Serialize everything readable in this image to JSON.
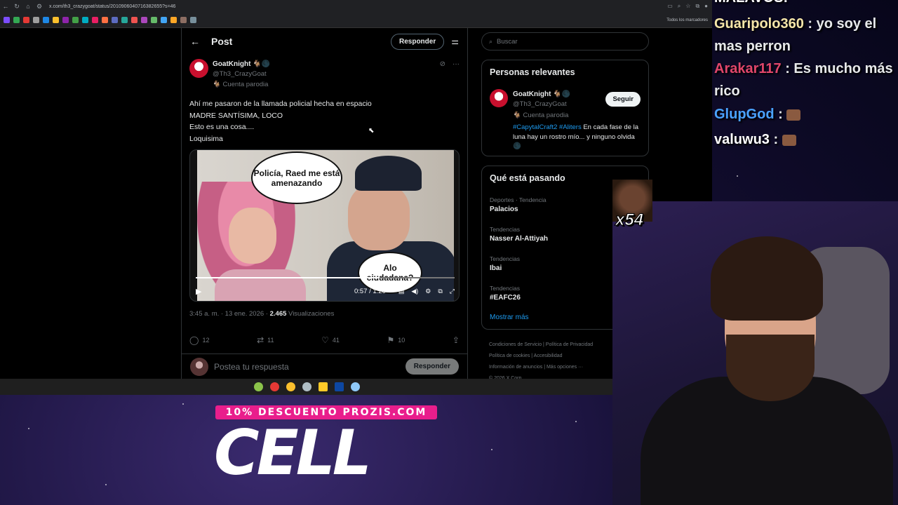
{
  "browser": {
    "url": "x.com/th3_crazygoat/status/2010906040716382655?s=46",
    "bookmarks_all": "Todos los marcadores"
  },
  "post": {
    "header_title": "Post",
    "reply_top_label": "Responder",
    "author_name": "GoatKnight 🐐🌑",
    "author_handle": "@Th3_CrazyGoat",
    "author_tag": "🐐 Cuenta parodia",
    "text_lines": [
      "Ahí me pasaron de la llamada policial hecha en espacio",
      "MADRE SANTÍSIMA, LOCO",
      "Esto es una cosa....",
      "Loquisima"
    ],
    "meme_bubble_1": "Policía, Raed me está amenazando",
    "meme_bubble_2": "Alo ciudadana?",
    "video_time": "0:57 / 1:20",
    "video_progress": 0.71,
    "meta_time": "3:45 a. m. · 13 ene. 2026 · ",
    "meta_views": "2.465",
    "meta_views_label": " Visualizaciones",
    "actions": {
      "replies": "12",
      "reposts": "11",
      "likes": "41",
      "bookmarks": "10"
    },
    "reply_placeholder": "Postea tu respuesta",
    "reply_submit": "Responder"
  },
  "sidebar": {
    "search_placeholder": "Buscar",
    "people_title": "Personas relevantes",
    "rel_name": "GoatKnight 🐐🌑",
    "rel_handle": "@Th3_CrazyGoat",
    "rel_tag": "🐐 Cuenta parodia",
    "rel_bio_tag1": "#CapytalCraft2",
    "rel_bio_tag2": "#Aliters",
    "rel_bio_text": " En cada fase de la luna hay un rostro mío... y ninguno olvida 🌑",
    "follow_label": "Seguir",
    "trends_title": "Qué está pasando",
    "trends": [
      {
        "category": "Deportes · Tendencia",
        "name": "Palacios"
      },
      {
        "category": "Tendencias",
        "name": "Nasser Al-Attiyah"
      },
      {
        "category": "Tendencias",
        "name": "Ibai"
      },
      {
        "category": "Tendencias",
        "name": "#EAFC26"
      }
    ],
    "show_more": "Mostrar más",
    "footer_lines": [
      "Condiciones de Servicio  |  Política de Privacidad",
      "Política de cookies  |  Accesibilidad",
      "Información de anuncios  |  Más opciones ···",
      "© 2026 X Corp."
    ]
  },
  "chat": {
    "partial_top": "MALAVOS!",
    "lines": [
      {
        "user": "Guaripolo360",
        "color": "#f5e6a8",
        "text": " : yo soy el mas perron"
      },
      {
        "user": "Arakar117",
        "color": "#e0466a",
        "text": " : Es mucho más rico"
      },
      {
        "user": "GlupGod",
        "color": "#4aa3ff",
        "text": " : "
      },
      {
        "user": "valuwu3",
        "color": "#ffffff",
        "text": " : "
      }
    ],
    "emote_count": "x54"
  },
  "promo": {
    "discount": "10% DESCUENTO PROZIS.COM",
    "logo": "CELL"
  }
}
